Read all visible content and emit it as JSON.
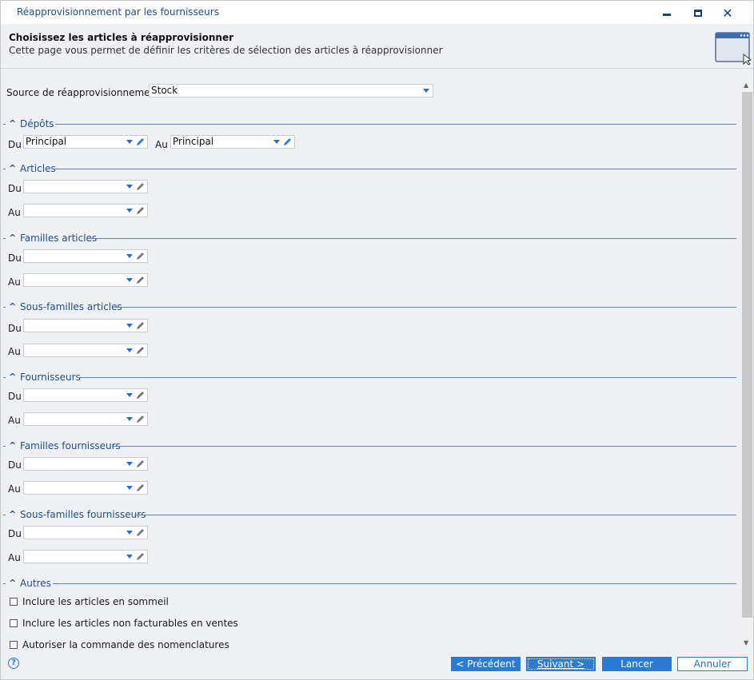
{
  "window": {
    "title": "Réapprovisionnement par les fournisseurs",
    "minimize_icon": "minimize-icon",
    "maximize_icon": "maximize-icon",
    "close_icon": "close-icon",
    "close_glyph": "✕"
  },
  "header": {
    "title": "Choisissez les articles à réapprovisionner",
    "subtitle": "Cette page vous permet de définir les critères de sélection des articles à réapprovisionner",
    "icon": "wizard-window-icon"
  },
  "source": {
    "label": "Source de réapprovisionnement",
    "value": "Stock"
  },
  "sections": {
    "depots": {
      "title": "Dépôts",
      "from_label": "Du",
      "from_value": "Principal",
      "to_label": "Au",
      "to_value": "Principal"
    },
    "articles": {
      "title": "Articles",
      "from_label": "Du",
      "from_value": "",
      "to_label": "Au",
      "to_value": ""
    },
    "familles_articles": {
      "title": "Familles articles",
      "from_label": "Du",
      "from_value": "",
      "to_label": "Au",
      "to_value": ""
    },
    "sous_familles_articles": {
      "title": "Sous-familles articles",
      "from_label": "Du",
      "from_value": "",
      "to_label": "Au",
      "to_value": ""
    },
    "fournisseurs": {
      "title": "Fournisseurs",
      "from_label": "Du",
      "from_value": "",
      "to_label": "Au",
      "to_value": ""
    },
    "familles_fournisseurs": {
      "title": "Familles fournisseurs",
      "from_label": "Du",
      "from_value": "",
      "to_label": "Au",
      "to_value": ""
    },
    "sous_familles_fournisseurs": {
      "title": "Sous-familles fournisseurs",
      "from_label": "Du",
      "from_value": "",
      "to_label": "Au",
      "to_value": ""
    },
    "autres": {
      "title": "Autres",
      "options": [
        {
          "label": "Inclure les articles en sommeil",
          "checked": false
        },
        {
          "label": "Inclure les articles non facturables en ventes",
          "checked": false
        },
        {
          "label": "Autoriser la commande des nomenclatures",
          "checked": false
        }
      ]
    }
  },
  "footer": {
    "help_glyph": "?",
    "previous": "< Précédent",
    "next": "Suivant >",
    "launch": "Lancer",
    "cancel": "Annuler"
  },
  "colors": {
    "accent": "#2b7bd6",
    "section_title": "#1c4f8c",
    "background": "#eef0f4"
  }
}
